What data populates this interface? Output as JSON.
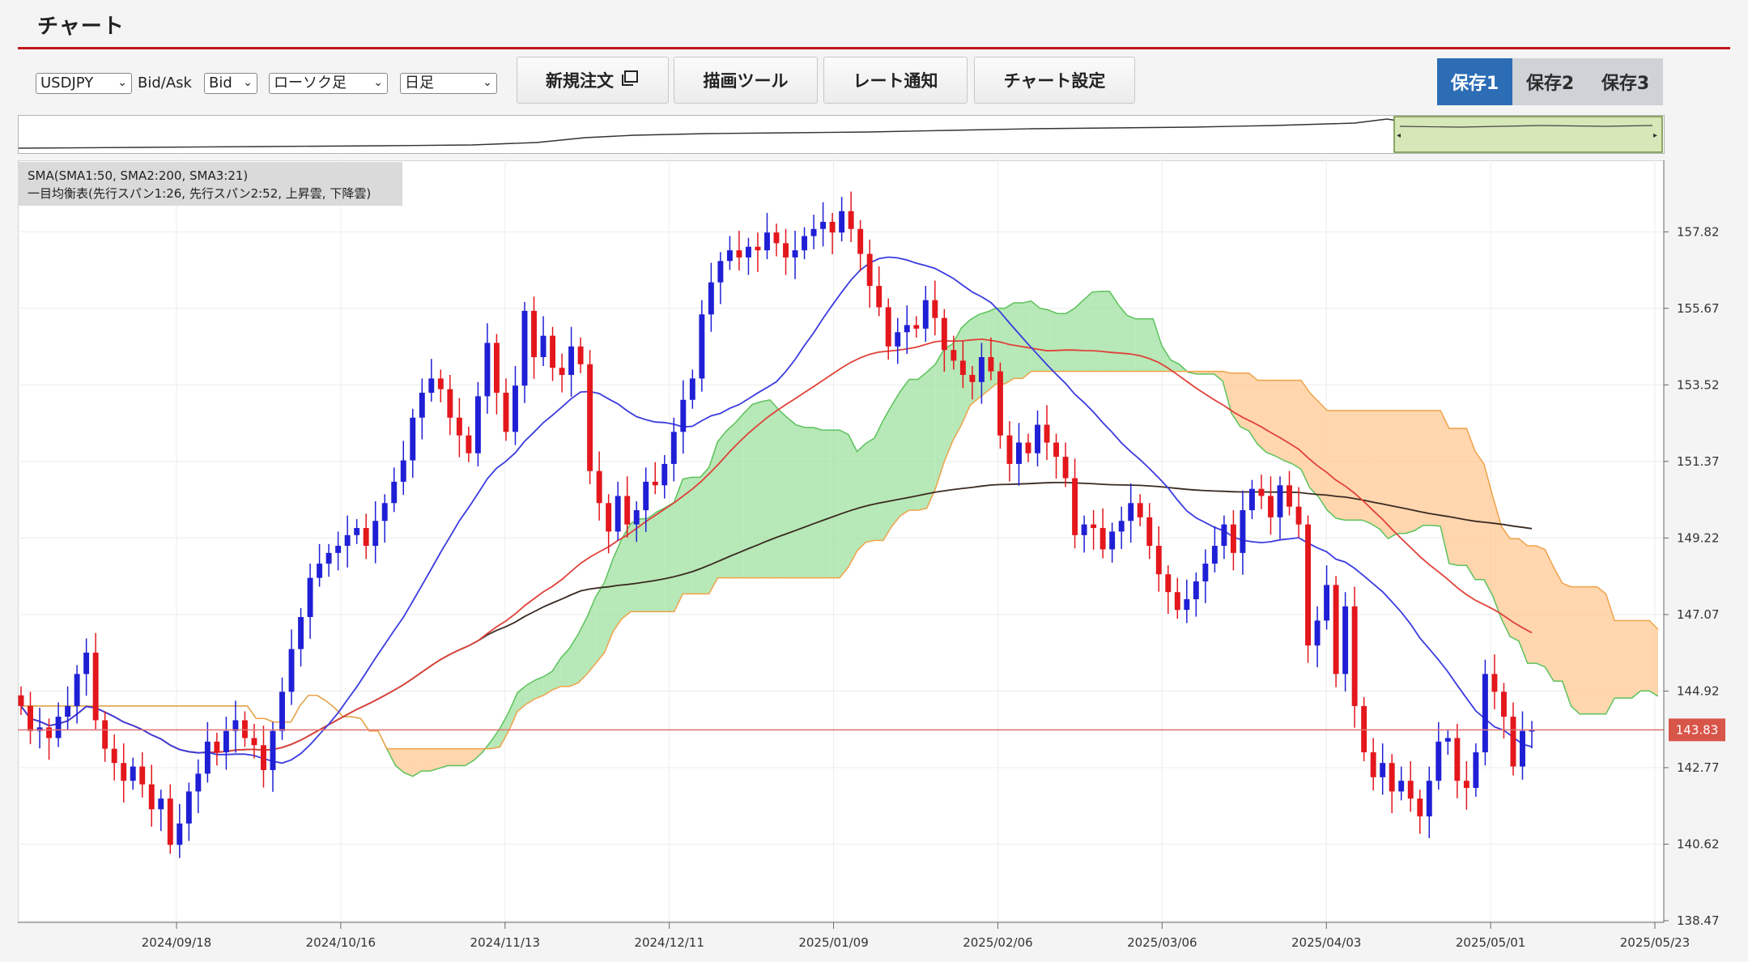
{
  "panel": {
    "title": "チャート"
  },
  "toolbar": {
    "symbol": "USDJPY",
    "bidask_label": "Bid/Ask",
    "bidask_value": "Bid",
    "chart_type": "ローソク足",
    "timeframe": "日足",
    "new_order_label": "新規注文",
    "drawing_tools_label": "描画ツール",
    "rate_alert_label": "レート通知",
    "chart_settings_label": "チャート設定",
    "save_buttons": [
      "保存1",
      "保存2",
      "保存3"
    ],
    "active_save": "保存1"
  },
  "legend": {
    "line1": "SMA(SMA1:50, SMA2:200, SMA3:21)",
    "line2": "一目均衡表(先行スパン1:26, 先行スパン2:52, 上昇雲, 下降雲)"
  },
  "colors": {
    "accent_red": "#c0161d",
    "up_candle": "#1f1fd6",
    "down_candle": "#e3171c",
    "sma_short": "#3b3be0",
    "sma_mid": "#e0413a",
    "sma_long": "#3a2a22",
    "cloud_up": "#9fe09f",
    "cloud_down": "#ffc891",
    "price_tag": "#d85549",
    "save_active": "#2c6db5"
  },
  "chart_data": {
    "type": "candlestick",
    "symbol": "USDJPY",
    "timeframe": "daily",
    "y_ticks": [
      "157.82",
      "155.67",
      "153.52",
      "151.37",
      "149.22",
      "147.07",
      "144.92",
      "142.77",
      "140.62",
      "138.47"
    ],
    "ylim": [
      138.47,
      159.6
    ],
    "x_ticks": [
      "2024/09/18",
      "2024/10/16",
      "2024/11/13",
      "2024/12/11",
      "2025/01/09",
      "2025/02/06",
      "2025/03/06",
      "2025/04/03",
      "2025/05/01",
      "2025/05/23"
    ],
    "current_price": "143.83",
    "closes": [
      144.5,
      143.8,
      143.9,
      143.6,
      144.2,
      144.5,
      145.4,
      146.0,
      144.1,
      143.3,
      142.9,
      142.4,
      142.8,
      142.3,
      141.6,
      141.9,
      140.6,
      141.2,
      142.1,
      142.6,
      143.5,
      143.2,
      143.8,
      144.1,
      143.6,
      143.4,
      142.7,
      143.8,
      144.9,
      146.1,
      147.0,
      148.1,
      148.5,
      148.8,
      149.0,
      149.3,
      149.5,
      149.0,
      149.7,
      150.2,
      150.8,
      151.4,
      152.6,
      153.3,
      153.7,
      153.4,
      152.6,
      152.1,
      151.6,
      153.2,
      154.7,
      153.3,
      152.2,
      153.5,
      155.6,
      154.3,
      154.9,
      154.0,
      153.8,
      154.6,
      154.1,
      151.1,
      150.2,
      149.4,
      150.4,
      149.6,
      150.0,
      150.8,
      150.7,
      151.3,
      152.2,
      153.1,
      153.7,
      155.5,
      156.4,
      157.0,
      157.3,
      157.1,
      157.4,
      157.3,
      157.8,
      157.5,
      157.1,
      157.3,
      157.7,
      157.9,
      158.1,
      157.8,
      158.4,
      157.9,
      157.2,
      156.3,
      155.7,
      154.6,
      155.0,
      155.2,
      155.1,
      155.9,
      155.4,
      154.5,
      154.2,
      153.8,
      153.6,
      154.3,
      153.9,
      152.1,
      151.3,
      151.9,
      151.6,
      152.4,
      151.9,
      151.5,
      150.9,
      149.3,
      149.6,
      149.5,
      148.9,
      149.4,
      149.7,
      150.2,
      149.8,
      149.0,
      148.2,
      147.7,
      147.2,
      147.5,
      148.0,
      148.5,
      149.0,
      149.6,
      148.8,
      150.0,
      150.6,
      150.4,
      149.8,
      150.7,
      150.1,
      149.6,
      146.2,
      146.9,
      147.9,
      145.4,
      147.3,
      144.5,
      143.2,
      142.5,
      142.9,
      142.1,
      142.4,
      141.9,
      141.4,
      142.4,
      143.5,
      143.6,
      142.4,
      142.2,
      143.2,
      145.4,
      144.9,
      144.2,
      142.8,
      143.8,
      143.83
    ],
    "sma_short_label": "SMA1:50",
    "sma_mid_label": "SMA2:200",
    "sma_long_label": "SMA3:21"
  }
}
